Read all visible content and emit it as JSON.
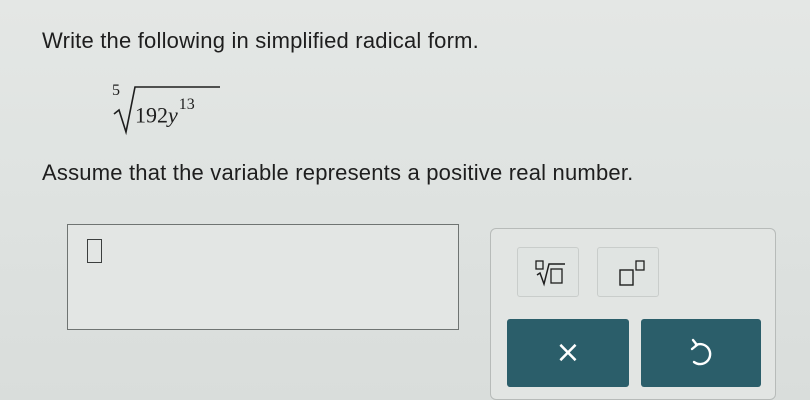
{
  "question": {
    "prompt": "Write the following in simplified radical form.",
    "expression": {
      "index": "5",
      "coefficient": "192",
      "variable": "y",
      "exponent": "13"
    },
    "assumption": "Assume that the variable represents a positive real number."
  },
  "answer": {
    "value": ""
  },
  "toolbar": {
    "nth_root_icon": "nth-root-template-icon",
    "exponent_icon": "exponent-template-icon",
    "clear_label": "×",
    "undo_icon": "undo-icon"
  },
  "colors": {
    "background": "#dfe3e1",
    "action_button": "#2b5e6a",
    "text": "#1e1e1e"
  }
}
